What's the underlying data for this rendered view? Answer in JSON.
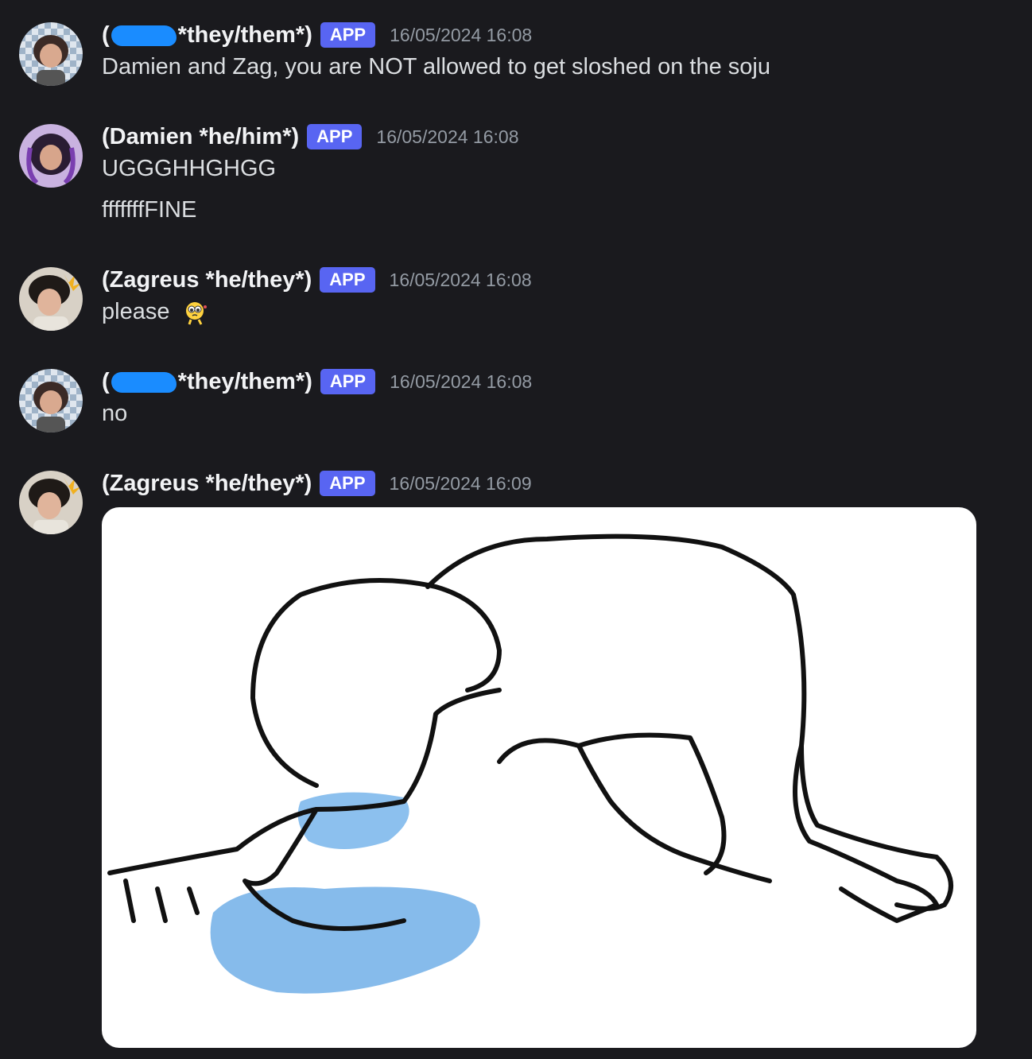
{
  "messages": [
    {
      "author_prefix": "(",
      "author_suffix": "*they/them*)",
      "badge": "APP",
      "timestamp": "16/05/2024 16:08",
      "lines": [
        "Damien and Zag, you are NOT allowed to get sloshed on the soju"
      ]
    },
    {
      "author": "(Damien *he/him*)",
      "badge": "APP",
      "timestamp": "16/05/2024 16:08",
      "lines": [
        "UGGGHHGHGG",
        "fffffffFINE"
      ]
    },
    {
      "author": "(Zagreus *he/they*)",
      "badge": "APP",
      "timestamp": "16/05/2024 16:08",
      "lines": [
        "please"
      ],
      "emoji": "pleading-face-emoji"
    },
    {
      "author_prefix": "(",
      "author_suffix": "*they/them*)",
      "badge": "APP",
      "timestamp": "16/05/2024 16:08",
      "lines": [
        "no"
      ]
    },
    {
      "author": "(Zagreus *he/they*)",
      "badge": "APP",
      "timestamp": "16/05/2024 16:09",
      "attachment": "crying-on-floor-drawing"
    }
  ],
  "colors": {
    "background": "#1a1a1e",
    "badge": "#5865f2",
    "timestamp": "#949ba4",
    "redaction": "#1a8cff"
  }
}
